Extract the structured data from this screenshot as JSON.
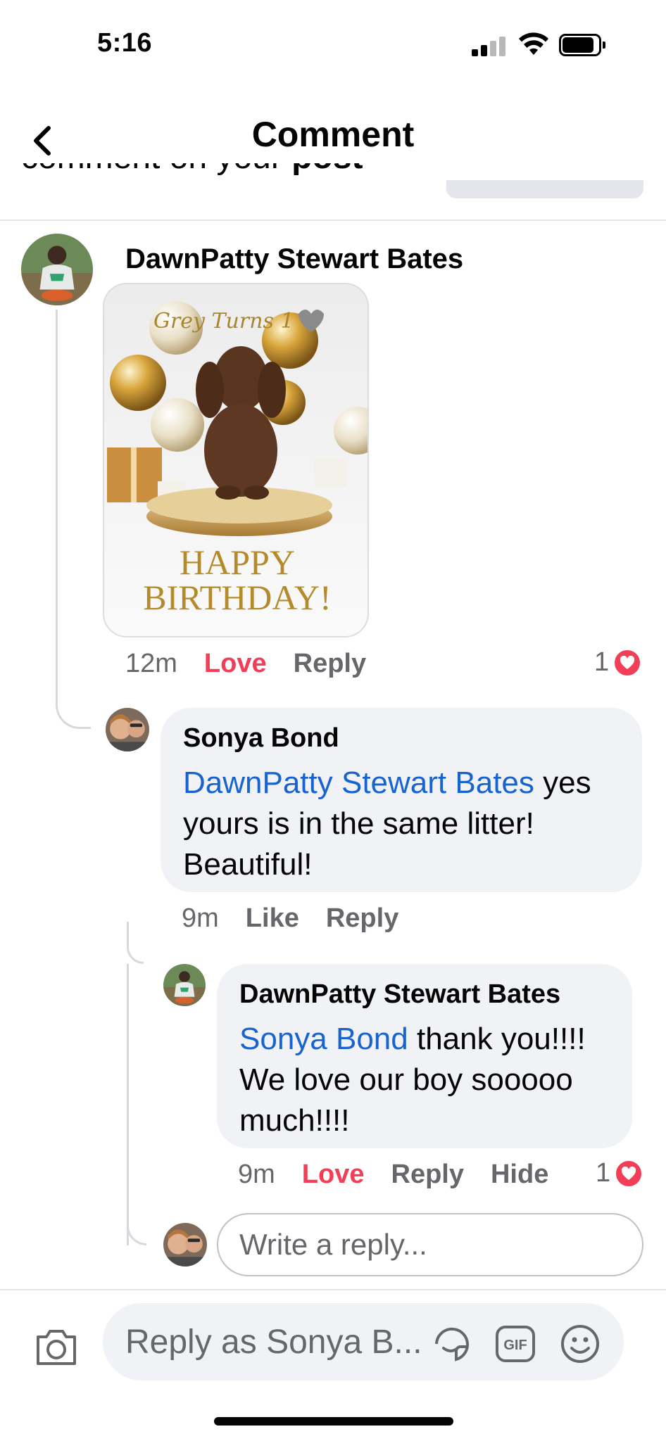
{
  "status_bar": {
    "time": "5:16"
  },
  "header": {
    "title": "Comment",
    "clipped_prev_text": "comment on your",
    "clipped_prev_bold": "post"
  },
  "comment": {
    "author": "DawnPatty Stewart Bates",
    "gif_text": {
      "script": "Grey Turns 1",
      "line1": "HAPPY",
      "line2": "BIRTHDAY!"
    },
    "time": "12m",
    "reaction_label": "Love",
    "reply_label": "Reply",
    "reaction_count": "1"
  },
  "reply1": {
    "author": "Sonya Bond",
    "mention": "DawnPatty Stewart Bates",
    "text_line1_rest": " yes",
    "text_line2": "yours is in the same litter!",
    "text_line3": "Beautiful!",
    "time": "9m",
    "like_label": "Like",
    "reply_label": "Reply"
  },
  "reply2": {
    "author": "DawnPatty Stewart Bates",
    "mention": "Sonya Bond",
    "text_line1_rest": " thank you!!!!",
    "text_line2": "We love our boy sooooo",
    "text_line3": "much!!!!",
    "time": "9m",
    "reaction_label": "Love",
    "reply_label": "Reply",
    "hide_label": "Hide",
    "reaction_count": "1"
  },
  "write_reply": {
    "placeholder": "Write a reply..."
  },
  "composer": {
    "placeholder": "Reply as Sonya B..."
  },
  "colors": {
    "love": "#f33e58",
    "mention": "#1763d0",
    "bubble": "#f0f2f5",
    "muted": "#65676b"
  },
  "icons": [
    "back-chevron-icon",
    "camera-icon",
    "sticker-icon",
    "gif-icon",
    "emoji-icon",
    "heart-icon"
  ]
}
